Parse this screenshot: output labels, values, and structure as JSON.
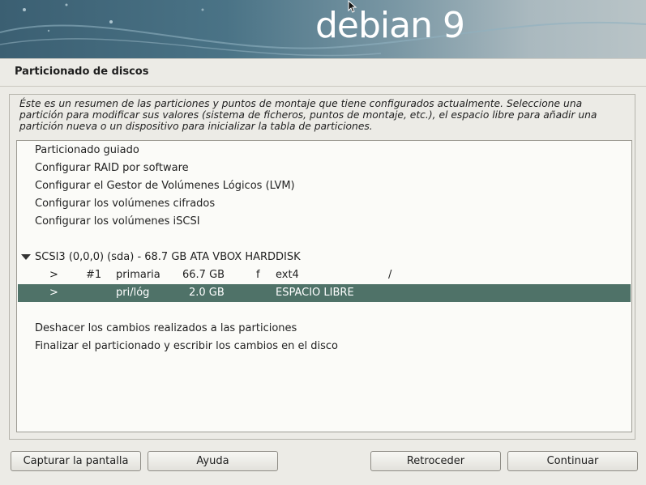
{
  "banner": {
    "logo_text": "debian 9"
  },
  "page_title": "Particionado de discos",
  "description": "Éste es un resumen de las particiones y puntos de montaje que tiene configurados actualmente. Seleccione una partición para modificar sus valores (sistema de ficheros, puntos de montaje, etc.), el espacio libre para añadir una partición nueva o un dispositivo para inicializar la tabla de particiones.",
  "menu": {
    "guided": "Particionado guiado",
    "raid": "Configurar RAID por software",
    "lvm": "Configurar el Gestor de Volúmenes Lógicos (LVM)",
    "crypto": "Configurar los volúmenes cifrados",
    "iscsi": "Configurar los volúmenes iSCSI"
  },
  "disk": {
    "label": "SCSI3 (0,0,0) (sda) - 68.7 GB ATA VBOX HARDDISK",
    "partitions": [
      {
        "arrow": ">",
        "number": "#1",
        "type": "primaria",
        "size": "66.7 GB",
        "flag": "f",
        "fs": "ext4",
        "mount": "/"
      },
      {
        "arrow": ">",
        "number": "",
        "type": "pri/lóg",
        "size": "2.0 GB",
        "flag": "",
        "fs": "ESPACIO LIBRE",
        "mount": ""
      }
    ],
    "selected_index": 1
  },
  "actions": {
    "undo": "Deshacer los cambios realizados a las particiones",
    "finish": "Finalizar el particionado y escribir los cambios en el disco"
  },
  "buttons": {
    "screenshot": "Capturar la pantalla",
    "help": "Ayuda",
    "back": "Retroceder",
    "continue": "Continuar"
  },
  "colors": {
    "selection": "#4f7268",
    "banner": "#3b5f72"
  }
}
